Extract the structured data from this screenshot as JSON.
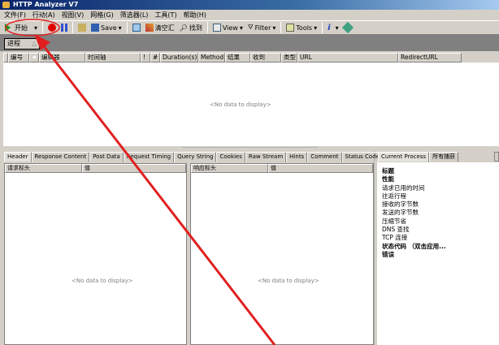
{
  "window": {
    "title": "HTTP Analyzer V7"
  },
  "menu": [
    "文件(F)",
    "行动(A)",
    "视图(V)",
    "网格(G)",
    "筛选器(L)",
    "工具(T)",
    "帮助(H)"
  ],
  "toolbar": {
    "start": "开始",
    "save": "Save",
    "clear": "清空汇",
    "find": "找到",
    "view": "View",
    "filter": "Filter",
    "tools": "Tools"
  },
  "group": {
    "label": "进程"
  },
  "columns": [
    "编号",
    "编辑器",
    "时间轴",
    "!",
    "#",
    "Duration(s)",
    "Method",
    "结果",
    "收到",
    "类型",
    "URL",
    "RedirectURL"
  ],
  "grid": {
    "empty": "<No data to display>"
  },
  "bottom_tabs": [
    "Header",
    "Response Content",
    "Post Data",
    "Request Timing",
    "Query String",
    "Cookies",
    "Raw Stream",
    "Hints",
    "Comment",
    "Status Code Definition"
  ],
  "request": {
    "col1": "请求标头",
    "col2": "值",
    "empty": "<No data to display>"
  },
  "response": {
    "col1": "响应标头",
    "col2": "值",
    "empty": "<No data to display>"
  },
  "right_tabs": [
    "Current Process",
    "所有捕获"
  ],
  "right_list": [
    {
      "label": "标题",
      "bold": true
    },
    {
      "label": "性能",
      "bold": true
    },
    {
      "label": "请求已用的时间"
    },
    {
      "label": "往返行程"
    },
    {
      "label": "接收的字节数"
    },
    {
      "label": "发送的字节数"
    },
    {
      "label": "压缩节省"
    },
    {
      "label": "DNS 查找"
    },
    {
      "label": "TCP 连接"
    },
    {
      "label": "状态代码 （双击应用...",
      "bold": true
    },
    {
      "label": "错误",
      "bold": true
    }
  ],
  "annotation_color": "#e02020"
}
